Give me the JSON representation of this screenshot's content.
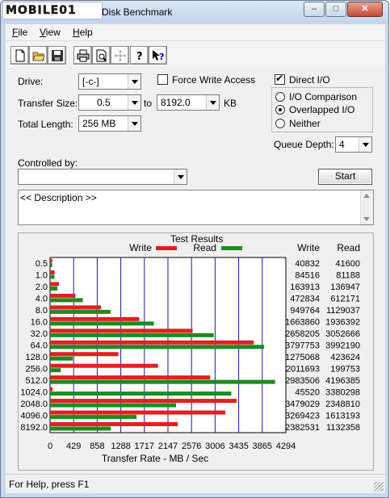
{
  "window": {
    "logo_text": "MOBILE01",
    "title": "Disk Benchmark"
  },
  "window_controls": {
    "minimize": "–",
    "maximize": "□",
    "close": "✕"
  },
  "menu": [
    {
      "key": "F",
      "rest": "ile"
    },
    {
      "key": "V",
      "rest": "iew"
    },
    {
      "key": "H",
      "rest": "elp"
    }
  ],
  "toolbar": {
    "icons": [
      "new-icon",
      "open-icon",
      "save-icon",
      "print-icon",
      "print-preview-icon",
      "move-icon",
      "help-icon",
      "context-help-icon"
    ]
  },
  "form": {
    "drive_label": "Drive:",
    "drive_value": "[-c-]",
    "transfer_size_label": "Transfer Size:",
    "transfer_from": "0.5",
    "to_label": "to",
    "transfer_to": "8192.0",
    "unit_label": "KB",
    "total_length_label": "Total Length:",
    "total_length_value": "256 MB",
    "force_write_access_label": "Force Write Access",
    "force_write_access_checked": false,
    "direct_io_label": "Direct I/O",
    "direct_io_checked": true,
    "radio_options": [
      "I/O Comparison",
      "Overlapped I/O",
      "Neither"
    ],
    "radio_selected": "Overlapped I/O",
    "queue_depth_label": "Queue Depth:",
    "queue_depth_value": "4",
    "controlled_by_label": "Controlled by:",
    "controlled_by_value": "",
    "start_label": "Start",
    "description_text": "<< Description >>"
  },
  "results": {
    "title": "Test Results"
  },
  "chart_data": {
    "type": "bar",
    "orientation": "horizontal",
    "categories": [
      "0.5",
      "1.0",
      "2.0",
      "4.0",
      "8.0",
      "16.0",
      "32.0",
      "64.0",
      "128.0",
      "256.0",
      "512.0",
      "1024.0",
      "2048.0",
      "4096.0",
      "8192.0"
    ],
    "series": [
      {
        "name": "Write",
        "color": "#e02020",
        "values": [
          40832,
          84516,
          163913,
          472834,
          949764,
          1663860,
          2658205,
          3797753,
          1275068,
          2011693,
          2983506,
          45520,
          3479029,
          3269423,
          2382531
        ]
      },
      {
        "name": "Read",
        "color": "#1f8a1f",
        "values": [
          41600,
          81188,
          136947,
          612171,
          1129037,
          1936392,
          3052666,
          3992190,
          423624,
          199753,
          4196385,
          3380298,
          2348810,
          1613193,
          1132358
        ]
      }
    ],
    "column_headers": [
      "Write",
      "Read"
    ],
    "x_ticks": [
      "0",
      "429",
      "858",
      "1288",
      "1717",
      "2147",
      "2576",
      "3006",
      "3435",
      "3865",
      "4294"
    ],
    "xlim": [
      0,
      4294
    ],
    "xlabel": "Transfer Rate - MB / Sec",
    "legend": "top"
  },
  "status": {
    "text": "For Help, press F1"
  }
}
